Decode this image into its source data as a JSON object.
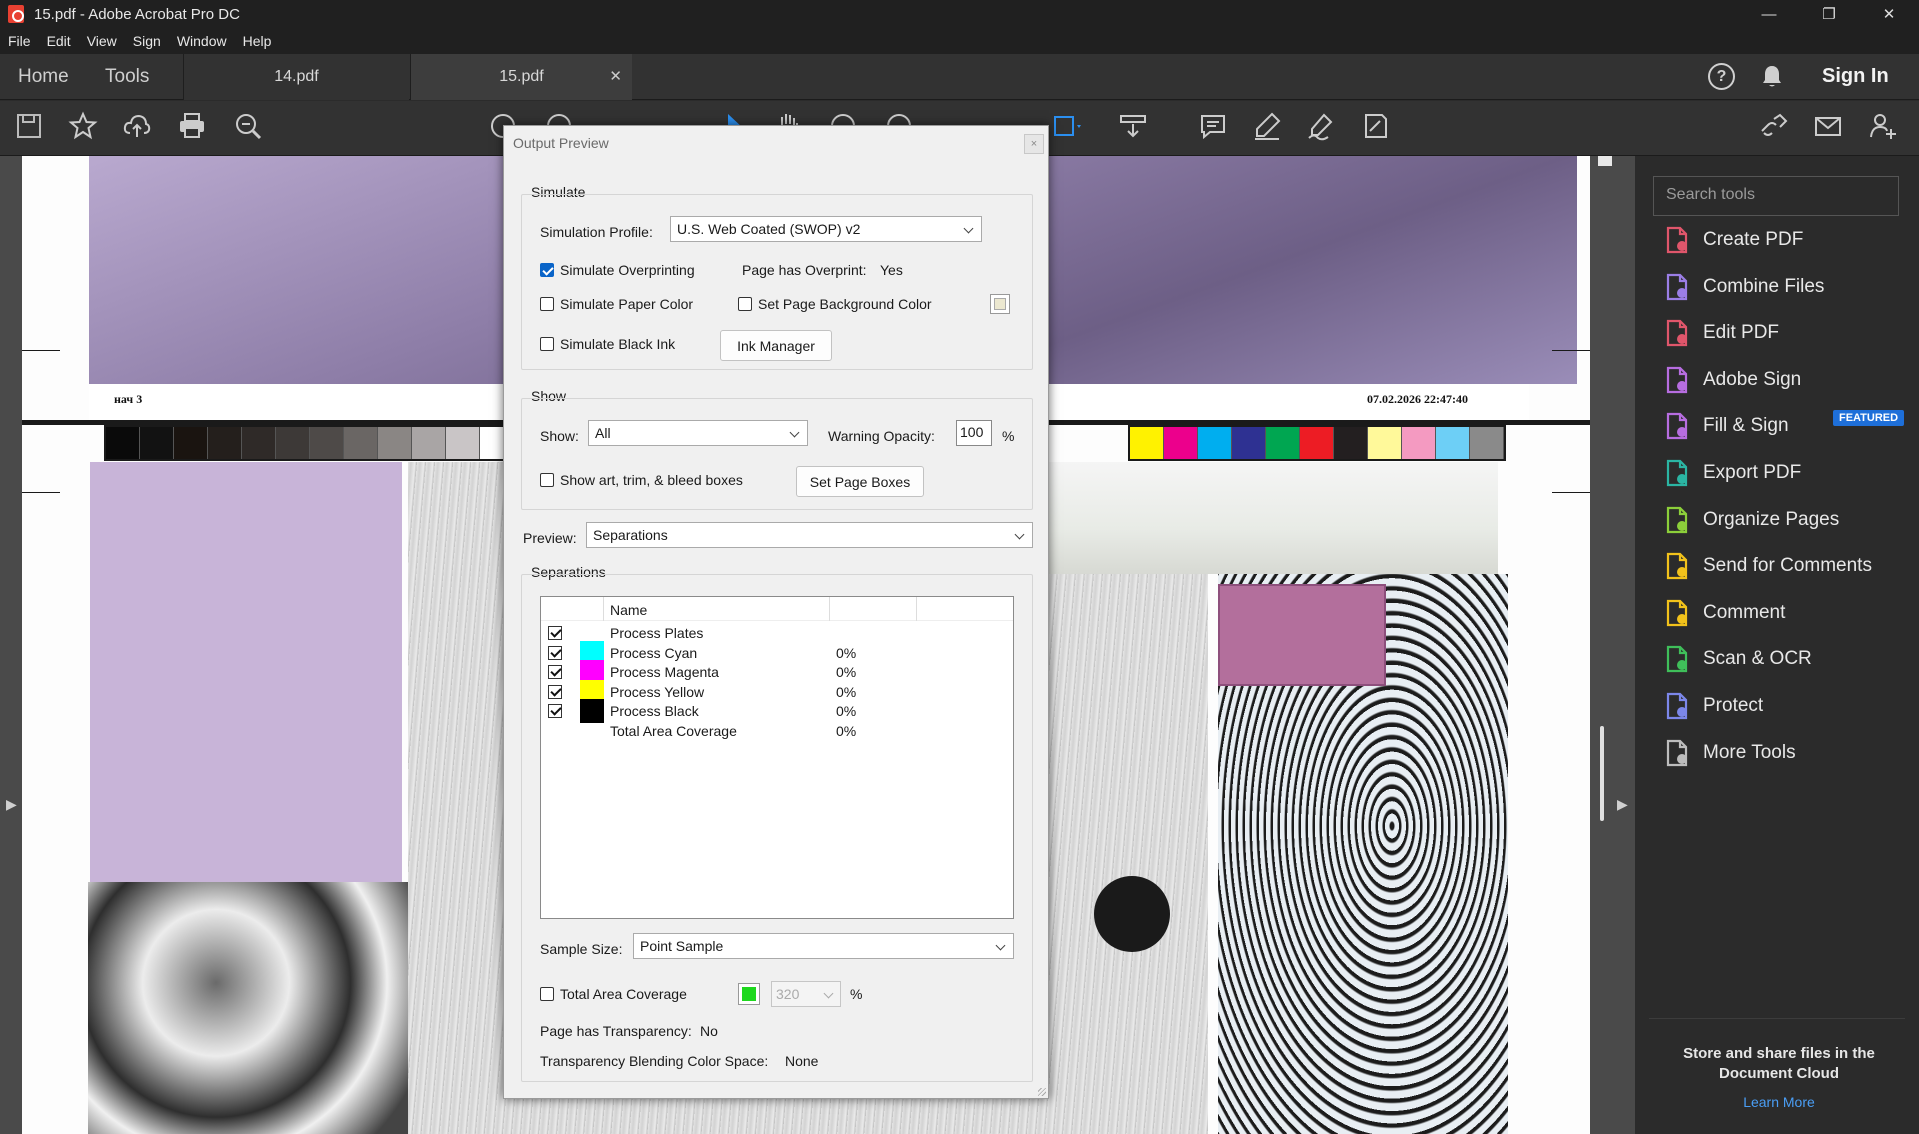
{
  "window": {
    "title": "15.pdf - Adobe Acrobat Pro DC",
    "minimize": "—",
    "maximize": "❐",
    "close": "✕"
  },
  "menu": [
    "File",
    "Edit",
    "View",
    "Sign",
    "Window",
    "Help"
  ],
  "tabs": {
    "home": "Home",
    "tools": "Tools",
    "doc1": "14.pdf",
    "doc2": "15.pdf",
    "close": "✕",
    "signin": "Sign In",
    "help": "?"
  },
  "toolbar_icons": [
    "save-icon",
    "star-icon",
    "upload-icon",
    "print-icon",
    "zoom-search-icon",
    "select-arrow-icon",
    "hand-icon",
    "marquee-zoom-icon",
    "fit-icon",
    "scroll-mode-icon",
    "comment-icon",
    "highlight-icon",
    "sign-icon",
    "edit-icon",
    "share-link-icon",
    "email-icon",
    "add-user-icon"
  ],
  "page_text": {
    "left": "нач  3",
    "right": "07.02.2026   22:47:40"
  },
  "colors": {
    "gray_bar": [
      "#0a0a0a",
      "#121212",
      "#1a1410",
      "#241f1c",
      "#2f2a28",
      "#3d3937",
      "#4e4a48",
      "#6a6664",
      "#8a8684",
      "#a9a5a5",
      "#c9c5c6",
      "#ffffff"
    ],
    "color_bar": [
      "#fff200",
      "#ec008c",
      "#00aeef",
      "#2e3192",
      "#00a651",
      "#ed1c24",
      "#231f20",
      "#fff99a",
      "#f49ac1",
      "#6dcff6",
      "#8a8a8a"
    ],
    "cyan": "#00ffff",
    "magenta": "#ff00ff",
    "yellow": "#ffff00",
    "black": "#000000"
  },
  "dialog": {
    "title": "Output Preview",
    "close": "×",
    "simulate": {
      "label": "Simulate",
      "profile_label": "Simulation Profile:",
      "profile_value": "U.S. Web Coated (SWOP) v2",
      "overprint_label": "Simulate Overprinting",
      "overprint_checked": true,
      "page_overprint_label": "Page has Overprint:",
      "page_overprint_value": "Yes",
      "paper_color_label": "Simulate Paper Color",
      "page_bg_label": "Set Page Background Color",
      "black_ink_label": "Simulate Black Ink",
      "ink_manager": "Ink Manager"
    },
    "show": {
      "label": "Show",
      "show_label": "Show:",
      "show_value": "All",
      "warning_label": "Warning Opacity:",
      "warning_value": "100",
      "percent": "%",
      "boxes_label": "Show art, trim, & bleed boxes",
      "set_boxes": "Set Page Boxes"
    },
    "preview": {
      "label": "Preview:",
      "value": "Separations"
    },
    "separations": {
      "label": "Separations",
      "col_name": "Name",
      "rows": [
        {
          "name": "Process Plates",
          "value": "",
          "checked": true,
          "color": ""
        },
        {
          "name": "Process Cyan",
          "value": "0%",
          "checked": true,
          "color": "#00ffff"
        },
        {
          "name": "Process Magenta",
          "value": "0%",
          "checked": true,
          "color": "#ff00ff"
        },
        {
          "name": "Process Yellow",
          "value": "0%",
          "checked": true,
          "color": "#ffff00"
        },
        {
          "name": "Process Black",
          "value": "0%",
          "checked": true,
          "color": "#000000"
        },
        {
          "name": "Total Area Coverage",
          "value": "0%",
          "checked": false,
          "color": ""
        }
      ]
    },
    "sample_size": {
      "label": "Sample Size:",
      "value": "Point Sample"
    },
    "tac": {
      "label": "Total Area Coverage",
      "value": "320",
      "percent": "%"
    },
    "transparency": {
      "label": "Page has Transparency:",
      "value": "No"
    },
    "blending": {
      "label": "Transparency Blending Color Space:",
      "value": "None"
    }
  },
  "right_panel": {
    "search_placeholder": "Search tools",
    "featured": "FEATURED",
    "tools": [
      {
        "label": "Create PDF",
        "icon": "create-pdf-icon",
        "color": "#e0566b"
      },
      {
        "label": "Combine Files",
        "icon": "combine-files-icon",
        "color": "#9b7ee6"
      },
      {
        "label": "Edit PDF",
        "icon": "edit-pdf-icon",
        "color": "#e0566b"
      },
      {
        "label": "Adobe Sign",
        "icon": "adobe-sign-icon",
        "color": "#b76de0"
      },
      {
        "label": "Fill & Sign",
        "icon": "fill-sign-icon",
        "color": "#b76de0"
      },
      {
        "label": "Export PDF",
        "icon": "export-pdf-icon",
        "color": "#2bb5a3"
      },
      {
        "label": "Organize Pages",
        "icon": "organize-pages-icon",
        "color": "#8ccf3a"
      },
      {
        "label": "Send for Comments",
        "icon": "send-comments-icon",
        "color": "#f2c21b"
      },
      {
        "label": "Comment",
        "icon": "comment-icon",
        "color": "#f2c21b"
      },
      {
        "label": "Scan & OCR",
        "icon": "scan-ocr-icon",
        "color": "#3fbf5a"
      },
      {
        "label": "Protect",
        "icon": "protect-icon",
        "color": "#7c87ea"
      },
      {
        "label": "More Tools",
        "icon": "more-tools-icon",
        "color": "#bdbdbd"
      }
    ],
    "cloud_text": "Store and share files in the Document Cloud",
    "learn_more": "Learn More"
  }
}
